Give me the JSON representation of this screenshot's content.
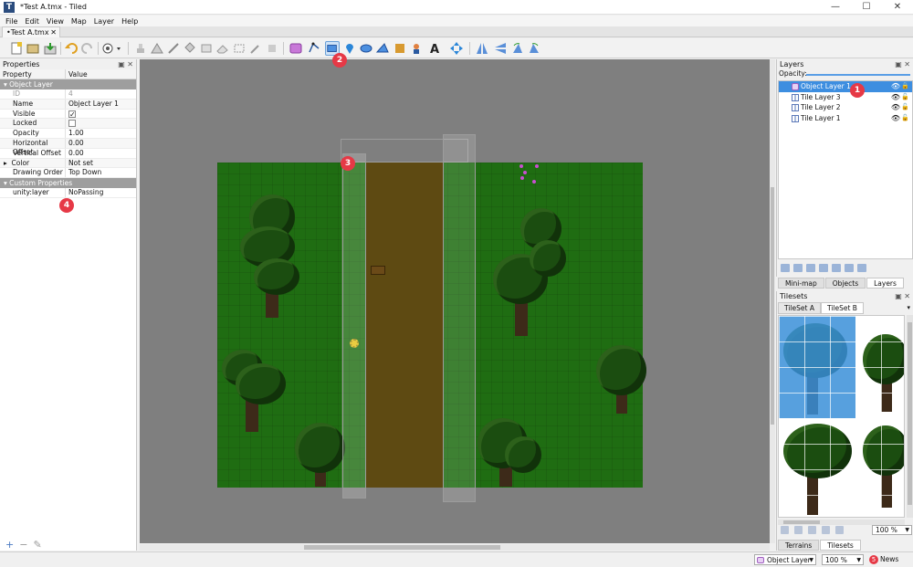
{
  "window": {
    "title": "*Test A.tmx - Tiled",
    "minimize": "—",
    "maximize": "☐",
    "close": "✕"
  },
  "menu": [
    "File",
    "Edit",
    "View",
    "Map",
    "Layer",
    "Help"
  ],
  "doc_tab": {
    "label": "•Test A.tmx",
    "close": "✕"
  },
  "toolbar": {
    "selected_tool": "rectangle-tool"
  },
  "badges": [
    "1",
    "2",
    "3",
    "4"
  ],
  "properties": {
    "title": "Properties",
    "col_property": "Property",
    "col_value": "Value",
    "group_object_layer": "Object Layer",
    "rows": [
      {
        "key": "ID",
        "value": "4"
      },
      {
        "key": "Name",
        "value": "Object Layer 1"
      },
      {
        "key": "Visible",
        "value": "✓"
      },
      {
        "key": "Locked",
        "value": ""
      },
      {
        "key": "Opacity",
        "value": "1.00"
      },
      {
        "key": "Horizontal Offset",
        "value": "0.00"
      },
      {
        "key": "Vertical Offset",
        "value": "0.00"
      },
      {
        "key": "Color",
        "value": "Not set"
      },
      {
        "key": "Drawing Order",
        "value": "Top Down"
      }
    ],
    "group_custom": "Custom Properties",
    "custom_rows": [
      {
        "key": "unity:layer",
        "value": "NoPassing"
      }
    ],
    "footer": [
      "+",
      "−",
      "✎"
    ]
  },
  "layers": {
    "title": "Layers",
    "opacity_label": "Opacity:",
    "items": [
      {
        "name": "Object Layer 1",
        "type": "object",
        "selected": true
      },
      {
        "name": "Tile Layer 3",
        "type": "tile",
        "selected": false
      },
      {
        "name": "Tile Layer 2",
        "type": "tile",
        "selected": false
      },
      {
        "name": "Tile Layer 1",
        "type": "tile",
        "selected": false
      }
    ],
    "tabs": [
      "Mini-map",
      "Objects",
      "Layers"
    ],
    "active_tab": "Layers"
  },
  "tilesets": {
    "title": "Tilesets",
    "tabs": [
      "TileSet A",
      "TileSet B"
    ],
    "active_tab": "TileSet B",
    "zoom": "100 %",
    "bottom_tabs": [
      "Terrains",
      "Tilesets"
    ],
    "active_bottom_tab": "Tilesets"
  },
  "status": {
    "current_layer": "Object Layer 1",
    "zoom": "100 %",
    "news_count": "5",
    "news_label": "News"
  },
  "colors": {
    "accent": "#3d8ee0",
    "badge": "#e63946",
    "grass": "#1f6d12",
    "road": "#5e4a12"
  }
}
